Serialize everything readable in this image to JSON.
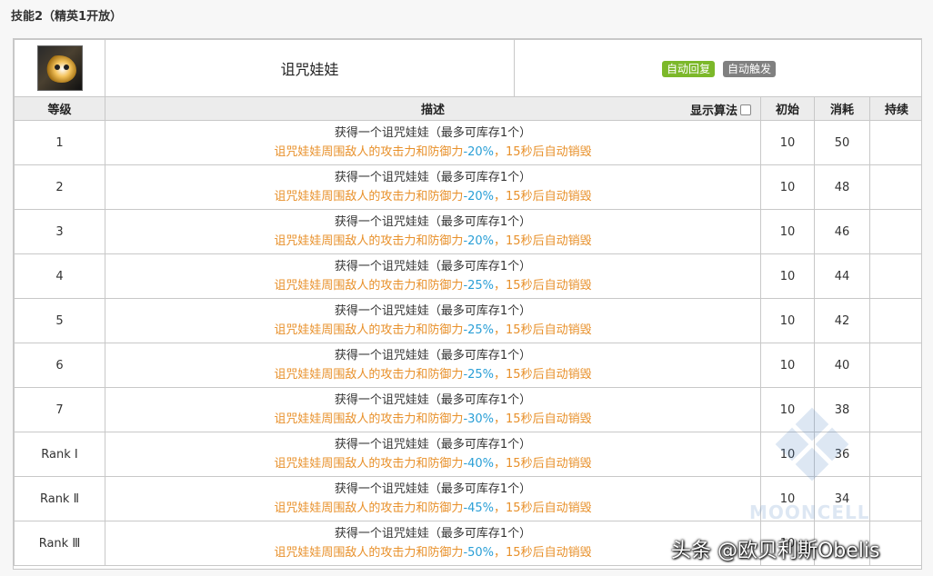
{
  "section_title": "技能2（精英1开放）",
  "skill": {
    "icon": "doll-skill-icon",
    "name": "诅咒娃娃",
    "tags": [
      {
        "label": "自动回复",
        "color": "#7cb82a"
      },
      {
        "label": "自动触发",
        "color": "#808080"
      }
    ]
  },
  "columns": {
    "level": "等级",
    "description": "描述",
    "show_formula": "显示算法",
    "initial": "初始",
    "cost": "消耗",
    "duration": "持续"
  },
  "rows": [
    {
      "level": "1",
      "line1": "获得一个诅咒娃娃（最多可库存1个）",
      "line2_pre": "诅咒娃娃周围敌人的攻击力和防御力",
      "value": "-20%",
      "line2_post": "，15秒后自动销毁",
      "initial": "10",
      "cost": "50",
      "duration": ""
    },
    {
      "level": "2",
      "line1": "获得一个诅咒娃娃（最多可库存1个）",
      "line2_pre": "诅咒娃娃周围敌人的攻击力和防御力",
      "value": "-20%",
      "line2_post": "，15秒后自动销毁",
      "initial": "10",
      "cost": "48",
      "duration": ""
    },
    {
      "level": "3",
      "line1": "获得一个诅咒娃娃（最多可库存1个）",
      "line2_pre": "诅咒娃娃周围敌人的攻击力和防御力",
      "value": "-20%",
      "line2_post": "，15秒后自动销毁",
      "initial": "10",
      "cost": "46",
      "duration": ""
    },
    {
      "level": "4",
      "line1": "获得一个诅咒娃娃（最多可库存1个）",
      "line2_pre": "诅咒娃娃周围敌人的攻击力和防御力",
      "value": "-25%",
      "line2_post": "，15秒后自动销毁",
      "initial": "10",
      "cost": "44",
      "duration": ""
    },
    {
      "level": "5",
      "line1": "获得一个诅咒娃娃（最多可库存1个）",
      "line2_pre": "诅咒娃娃周围敌人的攻击力和防御力",
      "value": "-25%",
      "line2_post": "，15秒后自动销毁",
      "initial": "10",
      "cost": "42",
      "duration": ""
    },
    {
      "level": "6",
      "line1": "获得一个诅咒娃娃（最多可库存1个）",
      "line2_pre": "诅咒娃娃周围敌人的攻击力和防御力",
      "value": "-25%",
      "line2_post": "，15秒后自动销毁",
      "initial": "10",
      "cost": "40",
      "duration": ""
    },
    {
      "level": "7",
      "line1": "获得一个诅咒娃娃（最多可库存1个）",
      "line2_pre": "诅咒娃娃周围敌人的攻击力和防御力",
      "value": "-30%",
      "line2_post": "，15秒后自动销毁",
      "initial": "10",
      "cost": "38",
      "duration": ""
    },
    {
      "level": "Rank Ⅰ",
      "line1": "获得一个诅咒娃娃（最多可库存1个）",
      "line2_pre": "诅咒娃娃周围敌人的攻击力和防御力",
      "value": "-40%",
      "line2_post": "，15秒后自动销毁",
      "initial": "10",
      "cost": "36",
      "duration": ""
    },
    {
      "level": "Rank Ⅱ",
      "line1": "获得一个诅咒娃娃（最多可库存1个）",
      "line2_pre": "诅咒娃娃周围敌人的攻击力和防御力",
      "value": "-45%",
      "line2_post": "，15秒后自动销毁",
      "initial": "10",
      "cost": "34",
      "duration": ""
    },
    {
      "level": "Rank Ⅲ",
      "line1": "获得一个诅咒娃娃（最多可库存1个）",
      "line2_pre": "诅咒娃娃周围敌人的攻击力和防御力",
      "value": "-50%",
      "line2_post": "，15秒后自动销毁",
      "initial": "10",
      "cost": "",
      "duration": ""
    }
  ],
  "watermark": "MOONCELL",
  "credit": "头条 @欧贝利斯Obelis"
}
